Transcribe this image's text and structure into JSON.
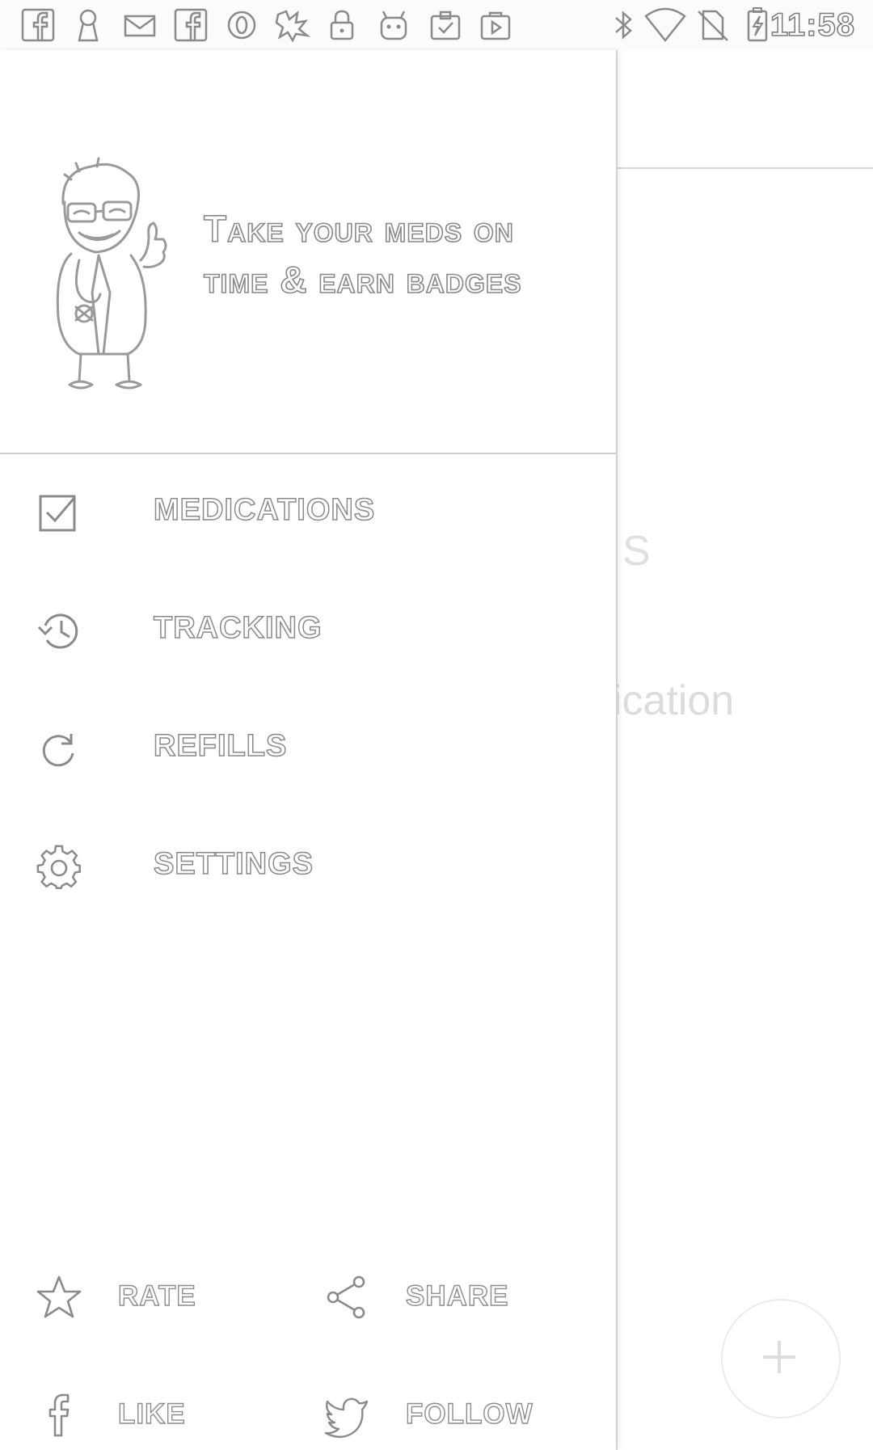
{
  "status_bar": {
    "time": "11:58",
    "left_icons": [
      "facebook-icon",
      "keyhole-icon",
      "mail-icon",
      "facebook-icon",
      "opera-icon",
      "app-icon",
      "lock-icon",
      "android-icon",
      "clipboard-icon",
      "play-store-icon"
    ],
    "right_icons": [
      "bluetooth-icon",
      "wifi-icon",
      "no-sim-icon",
      "battery-charging-icon"
    ]
  },
  "drawer": {
    "header": {
      "tagline_line1": "Take your meds on",
      "tagline_line2": "time & earn badges"
    },
    "menu": [
      {
        "label": "MEDICATIONS",
        "icon": "checkbox-icon"
      },
      {
        "label": "TRACKING",
        "icon": "history-icon"
      },
      {
        "label": "REFILLS",
        "icon": "refresh-icon"
      },
      {
        "label": "SETTINGS",
        "icon": "gear-icon"
      }
    ],
    "footer": {
      "rate": "RATE",
      "share": "SHARE",
      "like": "LIKE",
      "follow": "FOLLOW"
    }
  },
  "background": {
    "heading_fragment": "ONS",
    "subtitle_fragment": "edication",
    "fab_icon": "plus-icon"
  }
}
